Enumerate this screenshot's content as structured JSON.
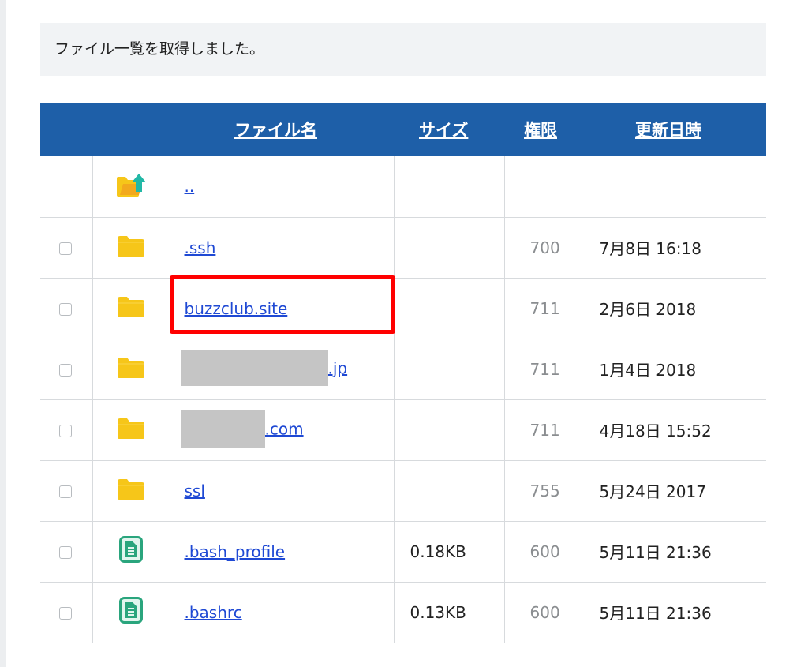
{
  "notice": {
    "text": "ファイル一覧を取得しました。"
  },
  "table": {
    "headers": {
      "name": "ファイル名",
      "size": "サイズ",
      "perm": "権限",
      "date": "更新日時"
    },
    "parent": {
      "name": "..",
      "icon": "folder-up-icon"
    },
    "rows": [
      {
        "icon": "folder-icon",
        "name": ".ssh",
        "size": "",
        "perm": "700",
        "date": "7月8日 16:18"
      },
      {
        "icon": "folder-icon",
        "name": "buzzclub.site",
        "size": "",
        "perm": "711",
        "date": "2月6日 2018"
      },
      {
        "icon": "folder-icon",
        "name": ".jp",
        "size": "",
        "perm": "711",
        "date": "1月4日 2018"
      },
      {
        "icon": "folder-icon",
        "name": ".com",
        "size": "",
        "perm": "711",
        "date": "4月18日 15:52"
      },
      {
        "icon": "folder-icon",
        "name": "ssl",
        "size": "",
        "perm": "755",
        "date": "5月24日 2017"
      },
      {
        "icon": "document-icon",
        "name": ".bash_profile",
        "size": "0.18KB",
        "perm": "600",
        "date": "5月11日 21:36"
      },
      {
        "icon": "document-icon",
        "name": ".bashrc",
        "size": "0.13KB",
        "perm": "600",
        "date": "5月11日 21:36"
      }
    ]
  },
  "colors": {
    "header_bg": "#1e5fa8",
    "link": "#1f49d4",
    "folder": "#f6c619",
    "document": "#2aa57d",
    "highlight": "#ff0000"
  }
}
